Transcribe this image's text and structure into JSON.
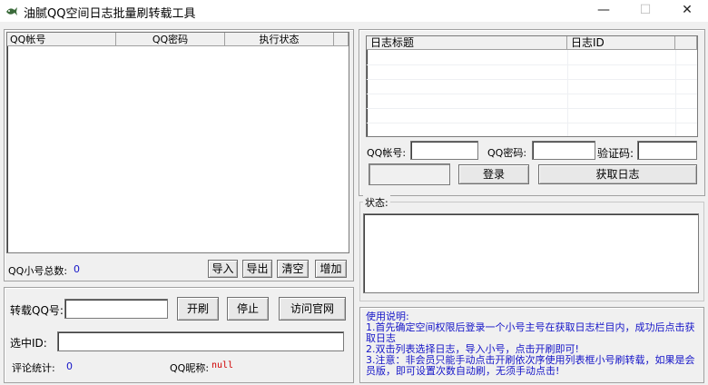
{
  "window": {
    "title": "油腻QQ空间日志批量刷转载工具",
    "minimize_glyph": "—",
    "maximize_glyph": "☐",
    "close_glyph": "✕"
  },
  "account_table": {
    "columns": [
      "QQ帐号",
      "QQ密码",
      "执行状态"
    ],
    "rows": []
  },
  "account_footer": {
    "total_label": "QQ小号总数:",
    "total_value": "0",
    "import_label": "导入",
    "export_label": "导出",
    "clear_label": "清空",
    "add_label": "增加"
  },
  "repost": {
    "qq_label": "转载QQ号:",
    "qq_value": "",
    "start_label": "开刷",
    "stop_label": "停止",
    "visit_label": "访问官网",
    "selected_id_label": "选中ID:",
    "selected_id_value": "",
    "comment_stats_label": "评论统计:",
    "comment_stats_value": "0",
    "nickname_label": "QQ昵称:",
    "nickname_value": "null"
  },
  "log_table": {
    "columns": [
      "日志标题",
      "日志ID"
    ],
    "rows": []
  },
  "login": {
    "qq_label": "QQ帐号:",
    "qq_value": "",
    "password_label": "QQ密码:",
    "password_value": "",
    "captcha_label": "验证码:",
    "captcha_value": "",
    "login_label": "登录",
    "fetch_logs_label": "获取日志"
  },
  "status": {
    "label": "状态:",
    "value": ""
  },
  "help": {
    "title": "使用说明:",
    "lines": [
      "1.首先确定空间权限后登录一个小号主号在获取日志栏目内，成功后点击获取日志",
      "2.双击列表选择日志，导入小号，点击开刷即可!",
      "3.注意：非会员只能手动点击开刷依次序使用列表框小号刷转载，如果是会员版，即可设置次数自动刷，无须手动点击!"
    ]
  },
  "colors": {
    "help_text": "#1515c8",
    "count_value": "#1515c8",
    "nickname_value": "#d00000"
  },
  "icons": {
    "app": "fish-app-icon"
  }
}
